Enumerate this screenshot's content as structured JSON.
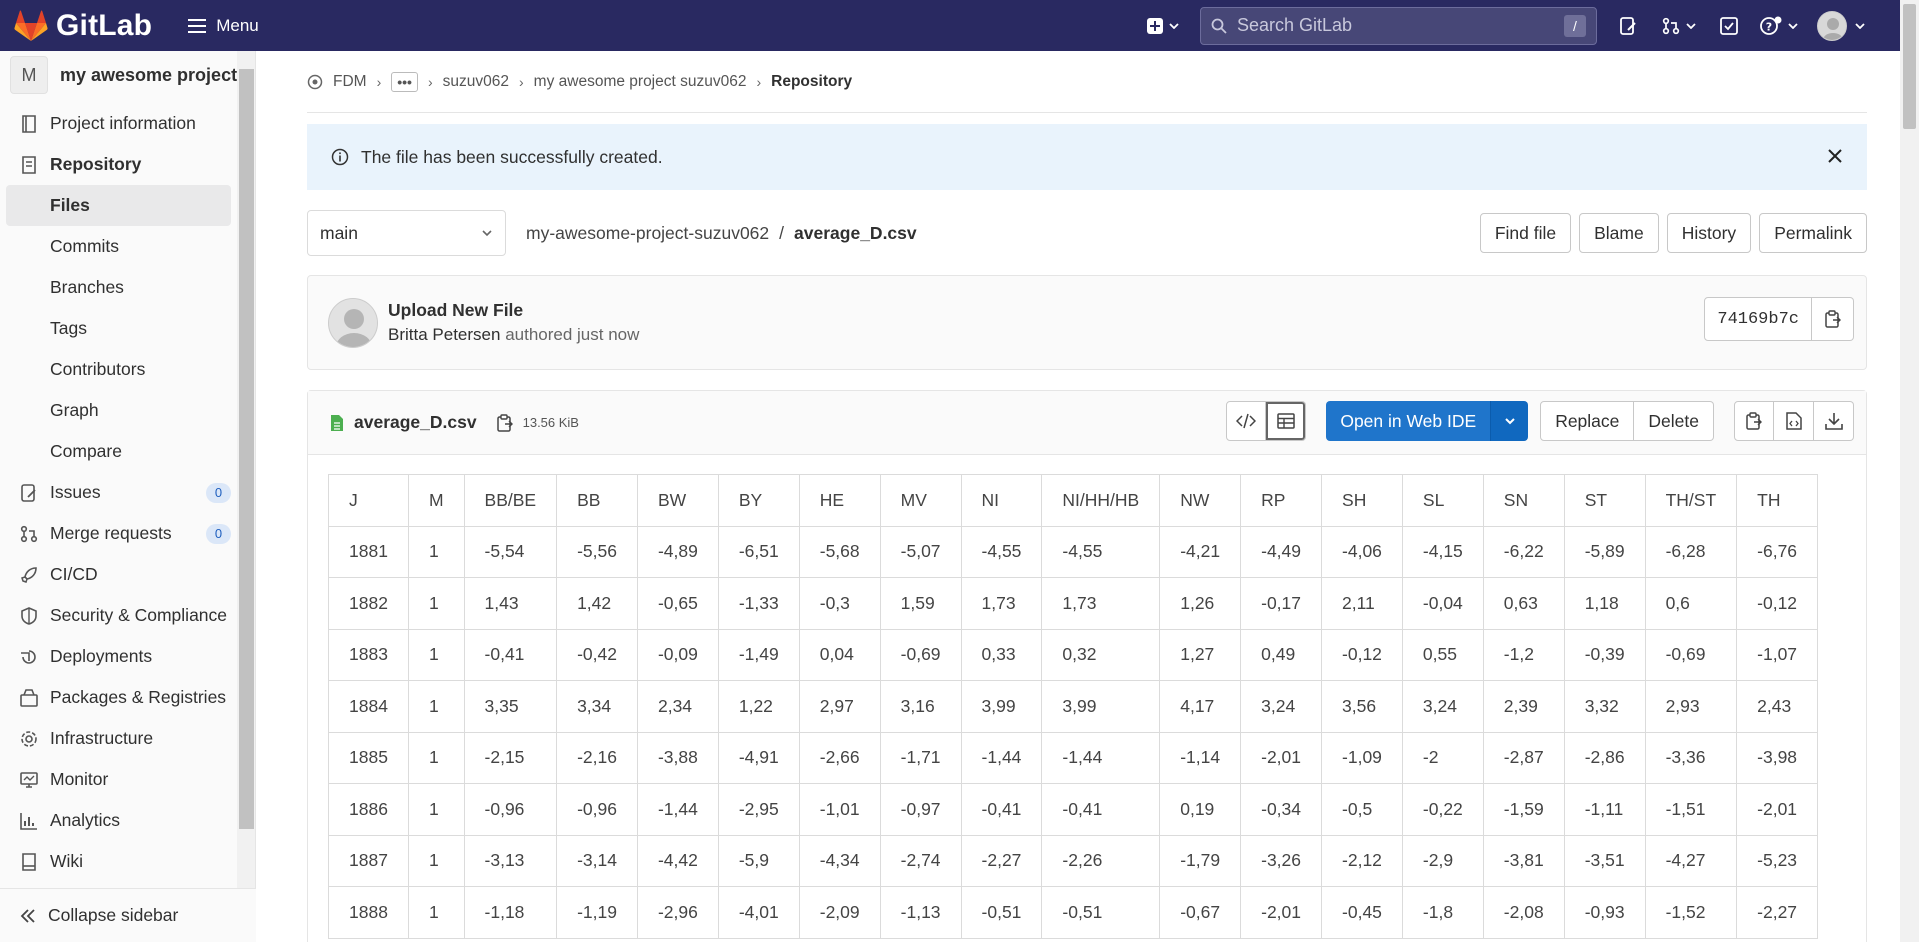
{
  "topbar": {
    "logo_text": "GitLab",
    "menu_label": "Menu",
    "search_placeholder": "Search GitLab",
    "search_shortcut": "/"
  },
  "sidebar": {
    "project_initial": "M",
    "project_name": "my awesome project su...",
    "items": [
      {
        "label": "Project information",
        "icon": "project-info-icon"
      },
      {
        "label": "Repository",
        "icon": "repository-icon"
      },
      {
        "label": "Files"
      },
      {
        "label": "Commits"
      },
      {
        "label": "Branches"
      },
      {
        "label": "Tags"
      },
      {
        "label": "Contributors"
      },
      {
        "label": "Graph"
      },
      {
        "label": "Compare"
      },
      {
        "label": "Issues",
        "icon": "issues-icon",
        "count": "0"
      },
      {
        "label": "Merge requests",
        "icon": "merge-request-icon",
        "count": "0"
      },
      {
        "label": "CI/CD",
        "icon": "rocket-icon"
      },
      {
        "label": "Security & Compliance",
        "icon": "shield-icon"
      },
      {
        "label": "Deployments",
        "icon": "deployments-icon"
      },
      {
        "label": "Packages & Registries",
        "icon": "package-icon"
      },
      {
        "label": "Infrastructure",
        "icon": "cloud-gear-icon"
      },
      {
        "label": "Monitor",
        "icon": "monitor-icon"
      },
      {
        "label": "Analytics",
        "icon": "chart-icon"
      },
      {
        "label": "Wiki",
        "icon": "book-icon"
      }
    ],
    "collapse_label": "Collapse sidebar"
  },
  "breadcrumb": {
    "root": "FDM",
    "ellipsis": "•••",
    "group": "suzuv062",
    "project": "my awesome project suzuv062",
    "current": "Repository"
  },
  "alert": {
    "message": "The file has been successfully created."
  },
  "filebar": {
    "branch": "main",
    "path_project": "my-awesome-project-suzuv062",
    "path_sep": "/",
    "path_file": "average_D.csv",
    "buttons": [
      "Find file",
      "Blame",
      "History",
      "Permalink"
    ]
  },
  "commit": {
    "title": "Upload New File",
    "author": "Britta Petersen",
    "meta": "authored just now",
    "sha": "74169b7c"
  },
  "viewer": {
    "file_name": "average_D.csv",
    "file_size": "13.56 KiB",
    "open_ide_label": "Open in Web IDE",
    "replace_label": "Replace",
    "delete_label": "Delete"
  },
  "table": {
    "headers": [
      "J",
      "M",
      "BB/BE",
      "BB",
      "BW",
      "BY",
      "HE",
      "MV",
      "NI",
      "NI/HH/HB",
      "NW",
      "RP",
      "SH",
      "SL",
      "SN",
      "ST",
      "TH/ST",
      "TH"
    ],
    "rows": [
      [
        "1881",
        "1",
        "-5,54",
        "-5,56",
        "-4,89",
        "-6,51",
        "-5,68",
        "-5,07",
        "-4,55",
        "-4,55",
        "-4,21",
        "-4,49",
        "-4,06",
        "-4,15",
        "-6,22",
        "-5,89",
        "-6,28",
        "-6,76"
      ],
      [
        "1882",
        "1",
        "1,43",
        "1,42",
        "-0,65",
        "-1,33",
        "-0,3",
        "1,59",
        "1,73",
        "1,73",
        "1,26",
        "-0,17",
        "2,11",
        "-0,04",
        "0,63",
        "1,18",
        "0,6",
        "-0,12"
      ],
      [
        "1883",
        "1",
        "-0,41",
        "-0,42",
        "-0,09",
        "-1,49",
        "0,04",
        "-0,69",
        "0,33",
        "0,32",
        "1,27",
        "0,49",
        "-0,12",
        "0,55",
        "-1,2",
        "-0,39",
        "-0,69",
        "-1,07"
      ],
      [
        "1884",
        "1",
        "3,35",
        "3,34",
        "2,34",
        "1,22",
        "2,97",
        "3,16",
        "3,99",
        "3,99",
        "4,17",
        "3,24",
        "3,56",
        "3,24",
        "2,39",
        "3,32",
        "2,93",
        "2,43"
      ],
      [
        "1885",
        "1",
        "-2,15",
        "-2,16",
        "-3,88",
        "-4,91",
        "-2,66",
        "-1,71",
        "-1,44",
        "-1,44",
        "-1,14",
        "-2,01",
        "-1,09",
        "-2",
        "-2,87",
        "-2,86",
        "-3,36",
        "-3,98"
      ],
      [
        "1886",
        "1",
        "-0,96",
        "-0,96",
        "-1,44",
        "-2,95",
        "-1,01",
        "-0,97",
        "-0,41",
        "-0,41",
        "0,19",
        "-0,34",
        "-0,5",
        "-0,22",
        "-1,59",
        "-1,11",
        "-1,51",
        "-2,01"
      ],
      [
        "1887",
        "1",
        "-3,13",
        "-3,14",
        "-4,42",
        "-5,9",
        "-4,34",
        "-2,74",
        "-2,27",
        "-2,26",
        "-1,79",
        "-3,26",
        "-2,12",
        "-2,9",
        "-3,81",
        "-3,51",
        "-4,27",
        "-5,23"
      ],
      [
        "1888",
        "1",
        "-1,18",
        "-1,19",
        "-2,96",
        "-4,01",
        "-2,09",
        "-1,13",
        "-0,51",
        "-0,51",
        "-0,67",
        "-2,01",
        "-0,45",
        "-1,8",
        "-2,08",
        "-0,93",
        "-1,52",
        "-2,27"
      ]
    ]
  },
  "colors": {
    "topbar": "#292961",
    "primary": "#1f75cb",
    "alert_bg": "#e9f3fc"
  }
}
